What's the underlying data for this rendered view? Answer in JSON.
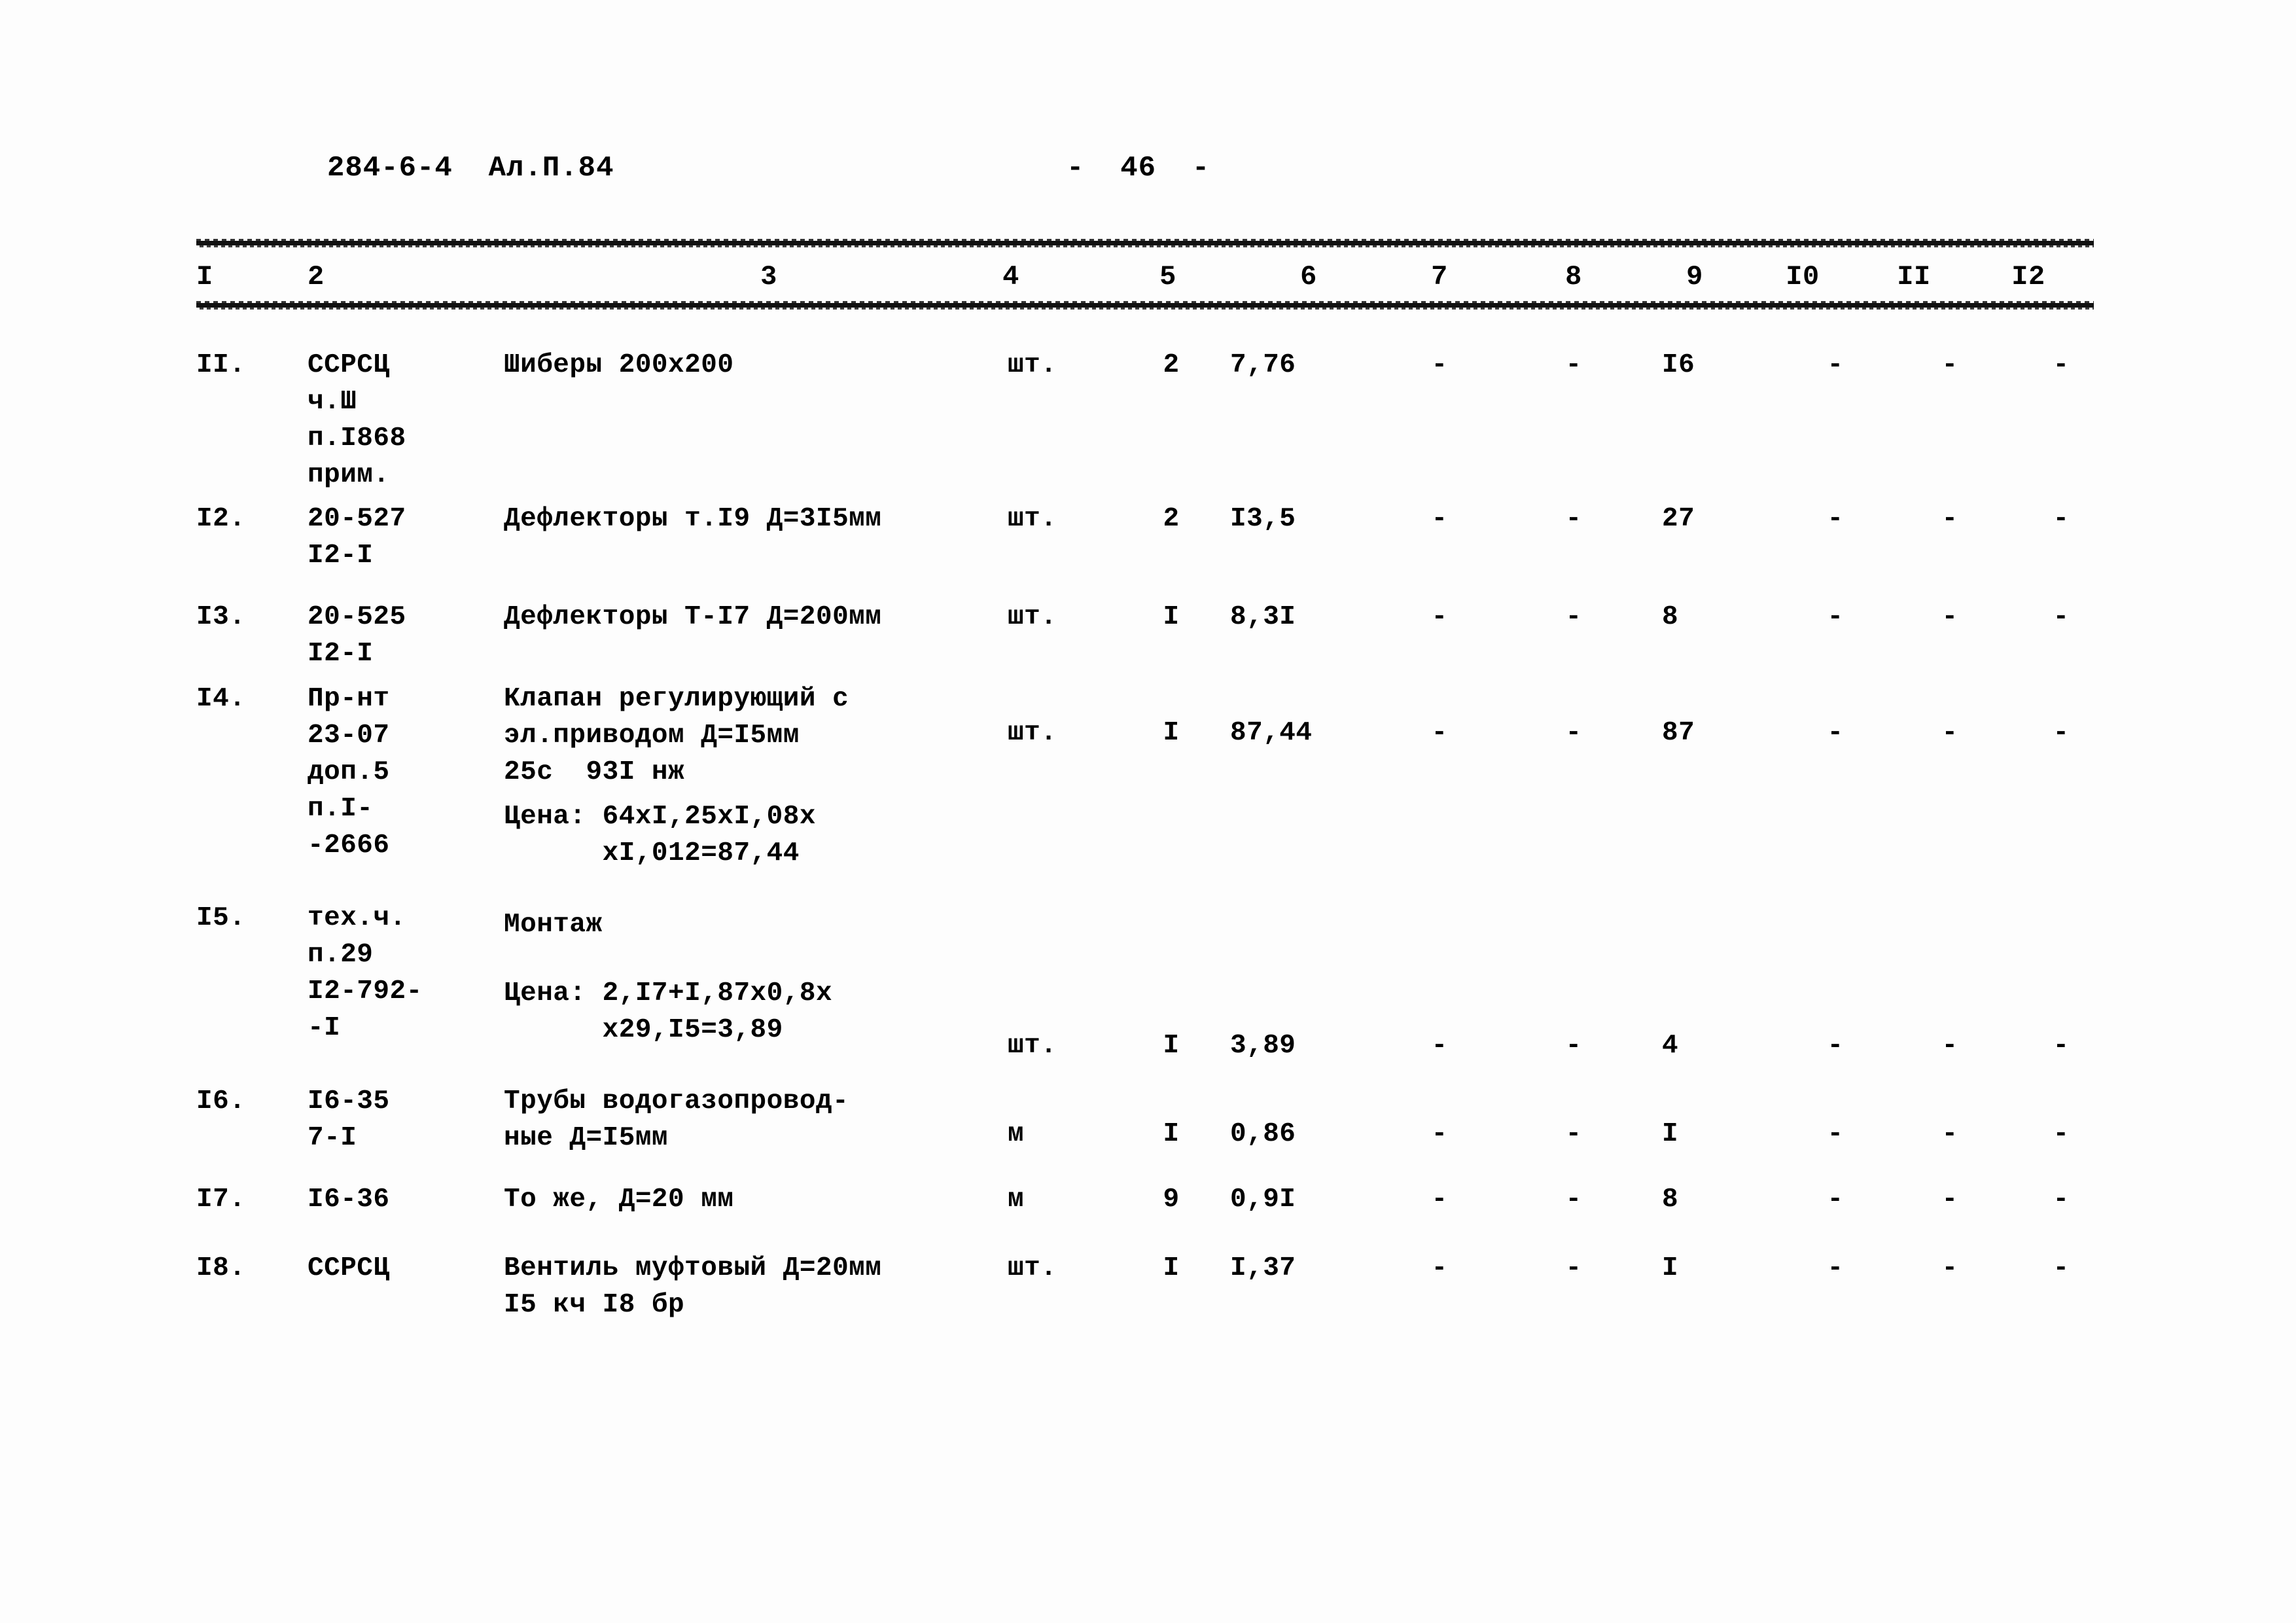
{
  "header": {
    "doc_code": "284-6-4  Ал.П.84",
    "page_marker": "-  46  -"
  },
  "table": {
    "column_headers": [
      "I",
      "2",
      "3",
      "4",
      "5",
      "6",
      "7",
      "8",
      "9",
      "I0",
      "II",
      "I2"
    ],
    "dash_glyph": "-",
    "rows": [
      {
        "num": "II.",
        "code": "ССРСЦ\nч.Ш\nп.I868\nприм.",
        "description": "Шиберы 200х200",
        "unit": "шт.",
        "qty": "2",
        "price": "7,76",
        "c7": "-",
        "c8": "-",
        "c9": "I6",
        "c10": "-",
        "c11": "-",
        "c12": "-"
      },
      {
        "num": "I2.",
        "code": "20-527\nI2-I",
        "description": "Дефлекторы т.I9 Д=3I5мм",
        "unit": "шт.",
        "qty": "2",
        "price": "I3,5",
        "c7": "-",
        "c8": "-",
        "c9": "27",
        "c10": "-",
        "c11": "-",
        "c12": "-"
      },
      {
        "num": "I3.",
        "code": "20-525\nI2-I",
        "description": "Дефлекторы Т-I7 Д=200мм",
        "unit": "шт.",
        "qty": "I",
        "price": "8,3I",
        "c7": "-",
        "c8": "-",
        "c9": "8",
        "c10": "-",
        "c11": "-",
        "c12": "-"
      },
      {
        "num": "I4.",
        "code": "Пр-нт\n23-07\nдоп.5\nп.I-\n-2666",
        "description": "Клапан регулирующий с\nэл.приводом Д=I5мм\n25с  93I нж",
        "description_extra": "Цена: 64хI,25хI,08х\n      хI,012=87,44",
        "unit": "шт.",
        "qty": "I",
        "price": "87,44",
        "c7": "-",
        "c8": "-",
        "c9": "87",
        "c10": "-",
        "c11": "-",
        "c12": "-"
      },
      {
        "num": "I5.",
        "code": "тех.ч.\nп.29\nI2-792-\n-I",
        "description": "Монтаж",
        "description_extra": "Цена: 2,I7+I,87х0,8х\n      х29,I5=3,89",
        "unit": "шт.",
        "qty": "I",
        "price": "3,89",
        "c7": "-",
        "c8": "-",
        "c9": "4",
        "c10": "-",
        "c11": "-",
        "c12": "-"
      },
      {
        "num": "I6.",
        "code": "I6-35\n7-I",
        "description": "Трубы водогазопровод-\nные Д=I5мм",
        "unit": "м",
        "qty": "I",
        "price": "0,86",
        "c7": "-",
        "c8": "-",
        "c9": "I",
        "c10": "-",
        "c11": "-",
        "c12": "-"
      },
      {
        "num": "I7.",
        "code": "I6-36",
        "description": "То же, Д=20 мм",
        "unit": "м",
        "qty": "9",
        "price": "0,9I",
        "c7": "-",
        "c8": "-",
        "c9": "8",
        "c10": "-",
        "c11": "-",
        "c12": "-"
      },
      {
        "num": "I8.",
        "code": "ССРСЦ",
        "description": "Вентиль муфтовый Д=20мм\nI5 кч I8 бр",
        "unit": "шт.",
        "qty": "I",
        "price": "I,37",
        "c7": "-",
        "c8": "-",
        "c9": "I",
        "c10": "-",
        "c11": "-",
        "c12": "-"
      }
    ]
  }
}
